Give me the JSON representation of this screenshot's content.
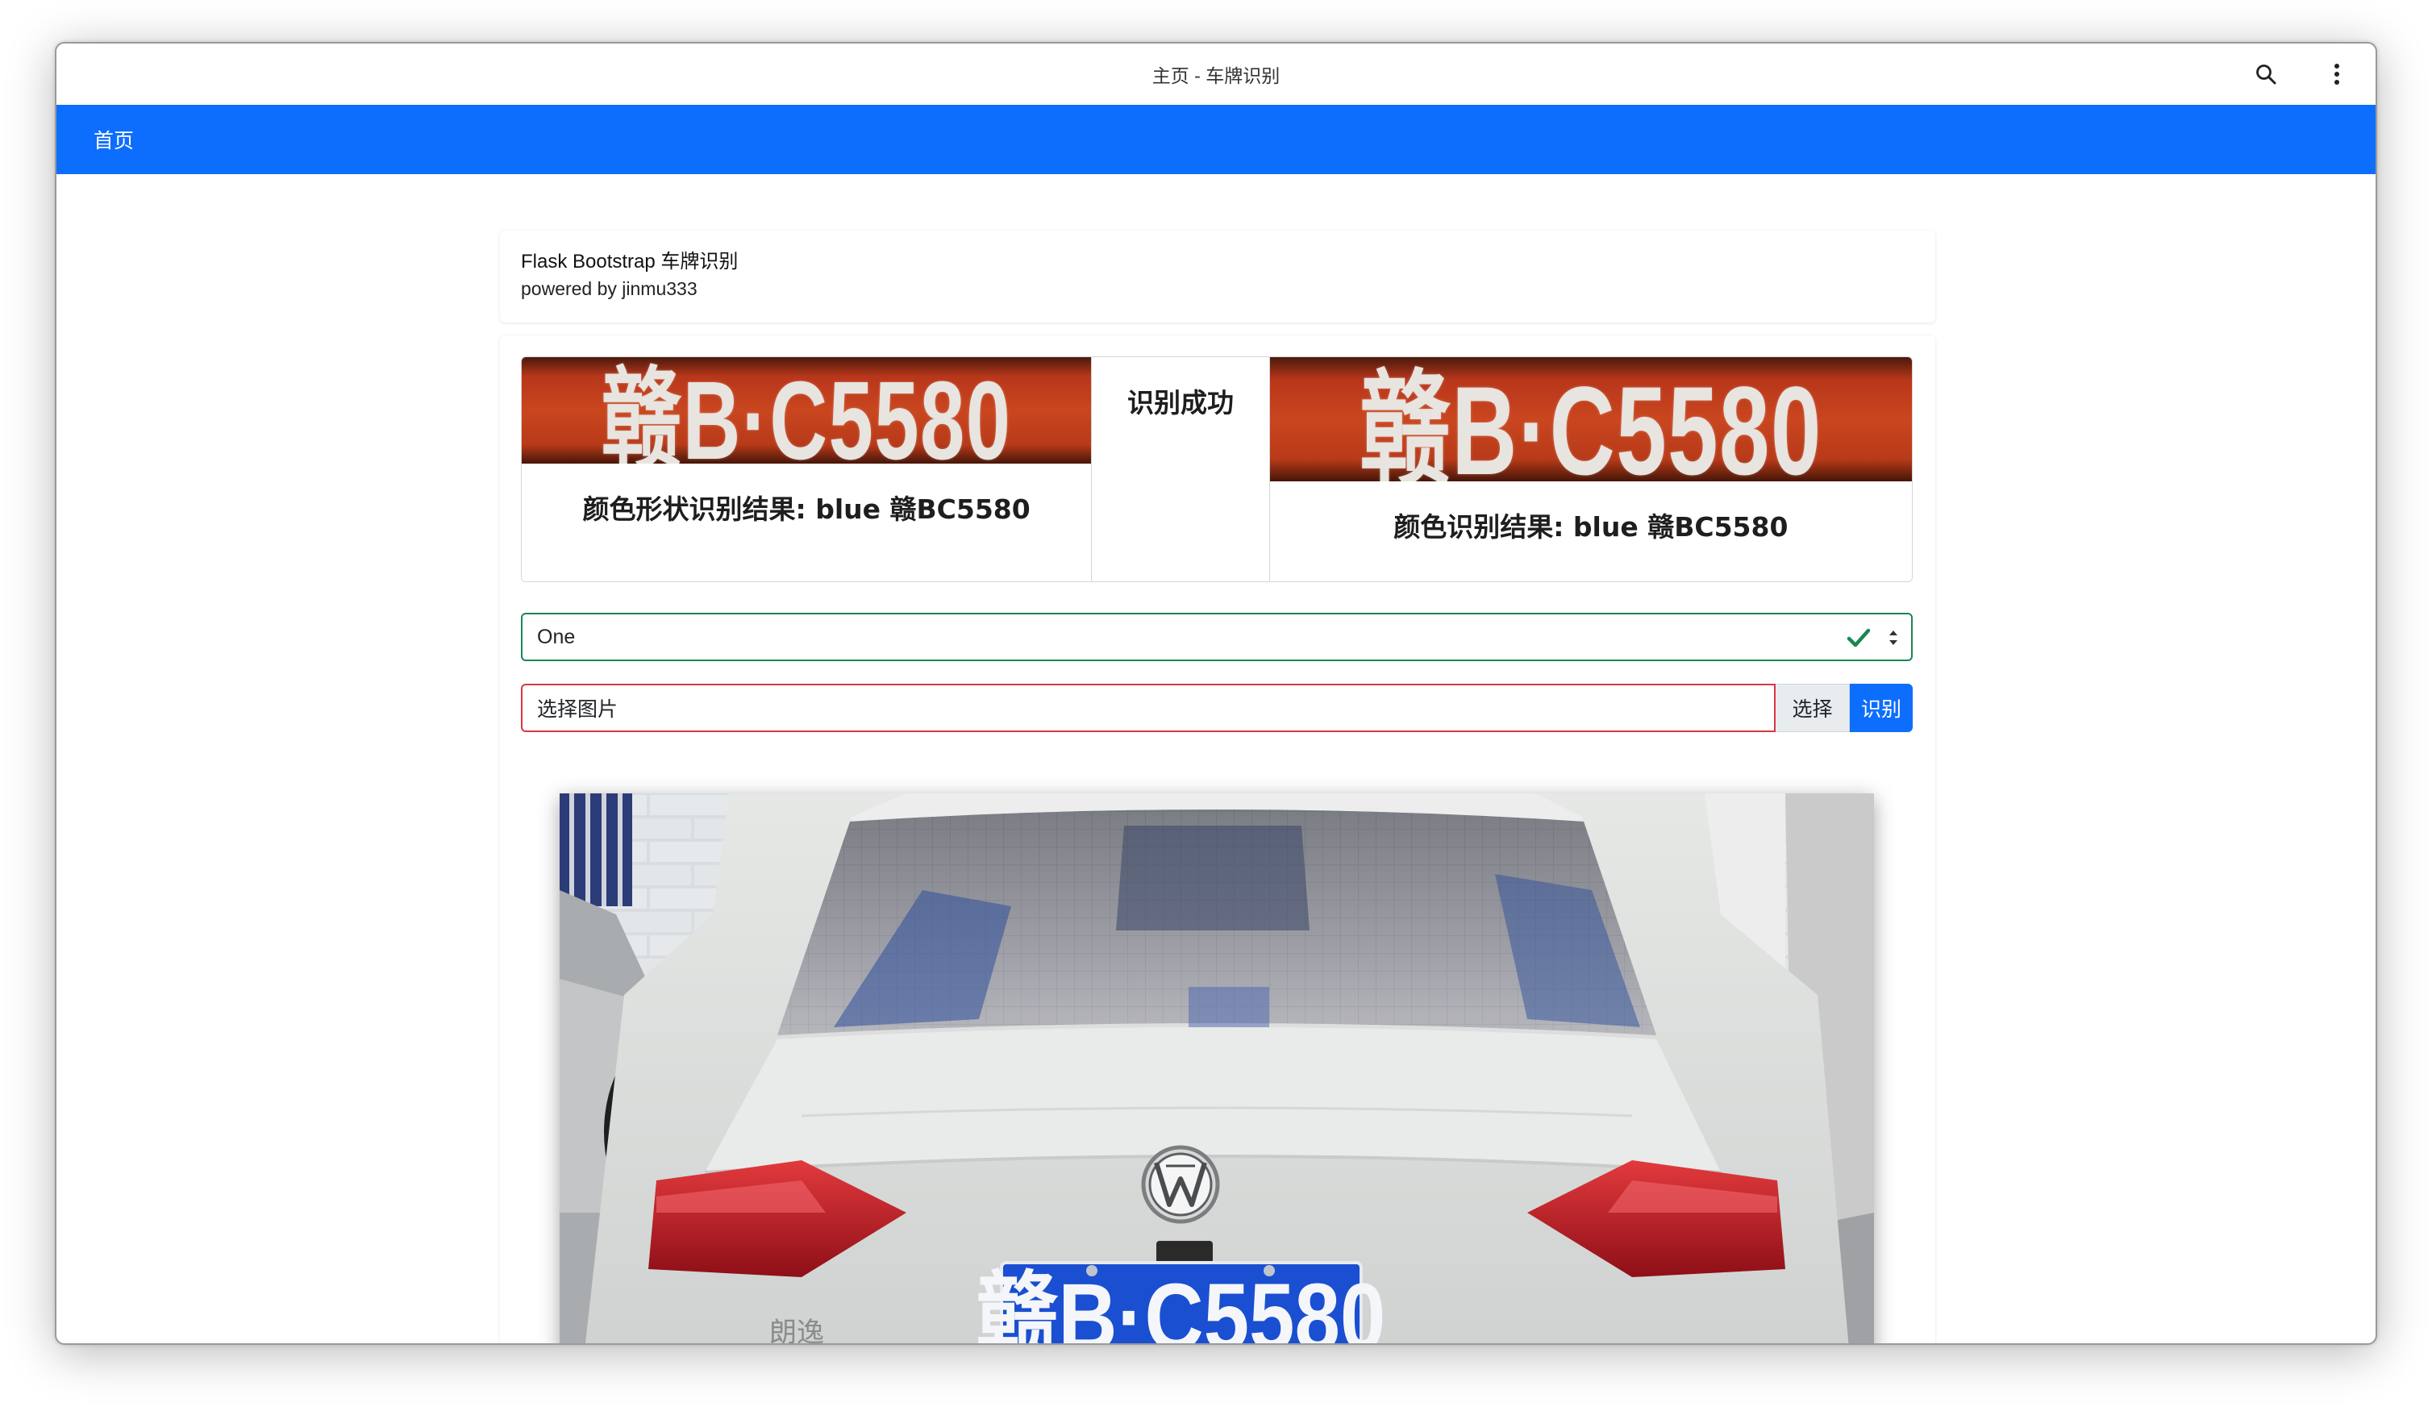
{
  "window": {
    "title": "主页 - 车牌识别"
  },
  "navbar": {
    "home_label": "首页"
  },
  "header": {
    "title": "Flask Bootstrap 车牌识别",
    "subtitle": "powered by jinmu333"
  },
  "results": {
    "plate_text": "赣B·C5580",
    "shape_result": "颜色形状识别结果: blue 赣BC5580",
    "status": "识别成功",
    "color_result": "颜色识别结果: blue 赣BC5580"
  },
  "form": {
    "select_value": "One",
    "file_placeholder": "选择图片",
    "choose_label": "选择",
    "recognize_label": "识别"
  },
  "photo": {
    "plate_text": "赣B·C5580",
    "rear_badge": "朗逸"
  },
  "colors": {
    "primary": "#0d6efd",
    "success": "#198754",
    "danger": "#dc3545",
    "plate_red": "#c9461f",
    "plate_blue": "#1a4fd1"
  },
  "icons": [
    "search-icon",
    "more-vertical-icon",
    "check-icon",
    "select-arrows-icon",
    "vw-logo-icon"
  ]
}
